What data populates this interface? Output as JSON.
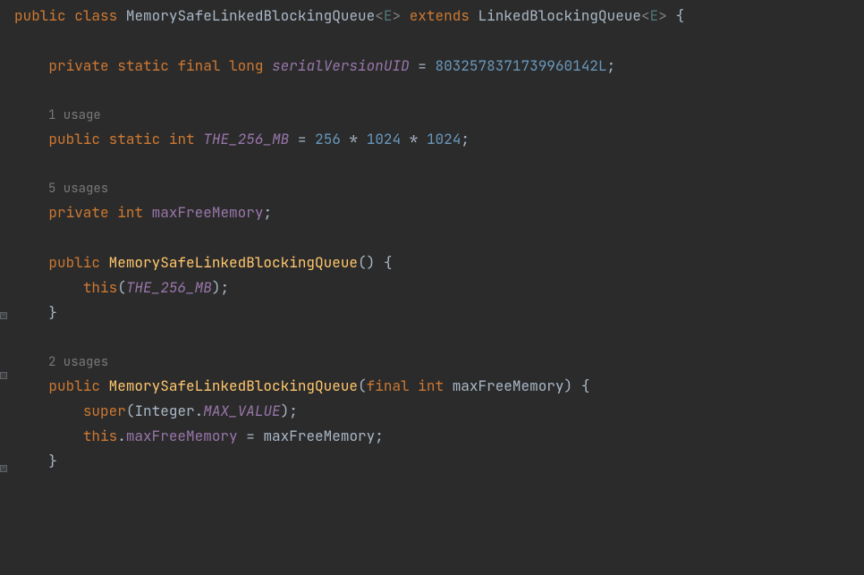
{
  "code": {
    "line1": {
      "public": "public",
      "class": "class",
      "className": "MemorySafeLinkedBlockingQueue",
      "lt1": "<",
      "generic1": "E",
      "gt1": ">",
      "extends": "extends",
      "parentClass": "LinkedBlockingQueue",
      "lt2": "<",
      "generic2": "E",
      "gt2": ">",
      "brace": " {"
    },
    "line2": {
      "private": "private",
      "static": "static",
      "final": "final",
      "long": "long",
      "fieldName": "serialVersionUID",
      "eq": " = ",
      "value": "8032578371739960142L",
      "semi": ";"
    },
    "usage1": "1 usage",
    "line3": {
      "public": "public",
      "static": "static",
      "int": "int",
      "fieldName": "THE_256_MB",
      "eq": " = ",
      "v1": "256",
      "op1": " * ",
      "v2": "1024",
      "op2": " * ",
      "v3": "1024",
      "semi": ";"
    },
    "usage2": "5 usages",
    "line4": {
      "private": "private",
      "int": "int",
      "fieldName": "maxFreeMemory",
      "semi": ";"
    },
    "line5": {
      "public": "public",
      "ctor": "MemorySafeLinkedBlockingQueue",
      "parens": "()",
      "brace": " {"
    },
    "line6": {
      "this": "this",
      "open": "(",
      "arg": "THE_256_MB",
      "close": ")",
      "semi": ";"
    },
    "line7": {
      "brace": "}"
    },
    "usage3": "2 usages",
    "line8": {
      "public": "public",
      "ctor": "MemorySafeLinkedBlockingQueue",
      "open": "(",
      "final": "final",
      "int": "int",
      "param": "maxFreeMemory",
      "close": ")",
      "brace": " {"
    },
    "line9": {
      "super": "super",
      "open": "(",
      "cls": "Integer",
      "dot": ".",
      "val": "MAX_VALUE",
      "close": ")",
      "semi": ";"
    },
    "line10": {
      "this": "this",
      "dot": ".",
      "field": "maxFreeMemory",
      "eq": " = ",
      "rhs": "maxFreeMemory",
      "semi": ";"
    },
    "line11": {
      "brace": "}"
    }
  }
}
